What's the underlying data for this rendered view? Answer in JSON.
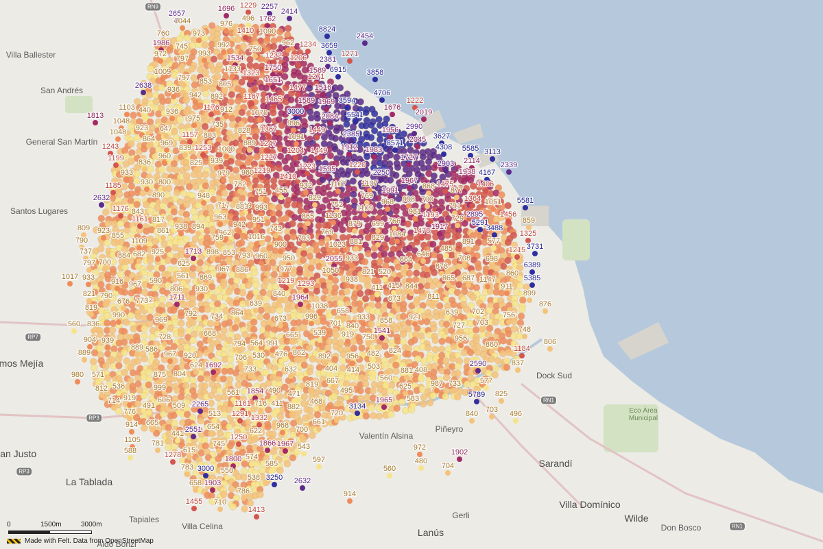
{
  "attribution": "Made with Felt. Data from OpenStreetMap",
  "scale": {
    "labels": [
      "0",
      "1500m",
      "3000m"
    ]
  },
  "colors": {
    "water": "#b6c9dc",
    "land": "#ecebe6",
    "park": "#d4e2c4",
    "palette": [
      "#f7e48a",
      "#f4c27a",
      "#ef8c5a",
      "#d4564e",
      "#a22a66",
      "#5b2a8a",
      "#2f2fa0"
    ]
  },
  "places": [
    {
      "name": "Villa Ballester"
    },
    {
      "name": "San Andrés"
    },
    {
      "name": "General San Martín"
    },
    {
      "name": "Santos Lugares"
    },
    {
      "name": "Ramos Mejía"
    },
    {
      "name": "San Justo"
    },
    {
      "name": "La Tablada"
    },
    {
      "name": "Tapiales"
    },
    {
      "name": "Villa Celina"
    },
    {
      "name": "Aldo Bonzi"
    },
    {
      "name": "Valentín Alsina"
    },
    {
      "name": "Piñeyro"
    },
    {
      "name": "Gerli"
    },
    {
      "name": "Lanús"
    },
    {
      "name": "Sarandí"
    },
    {
      "name": "Villa Domínico"
    },
    {
      "name": "Wilde"
    },
    {
      "name": "Don Bosco"
    },
    {
      "name": "Dock Sud"
    },
    {
      "name": "Eco Área Municipal"
    }
  ],
  "roads": [
    "RN9",
    "RP7",
    "RP3",
    "RP3",
    "RN1",
    "RN1"
  ],
  "labeled_points": [
    {
      "value": 2657
    },
    {
      "value": 1696
    },
    {
      "value": 1229
    },
    {
      "value": 2257
    },
    {
      "value": 2414
    },
    {
      "value": 1044
    },
    {
      "value": 976
    },
    {
      "value": 496
    },
    {
      "value": 1762
    },
    {
      "value": 760
    },
    {
      "value": 973
    },
    {
      "value": 1410
    },
    {
      "value": 1090
    },
    {
      "value": 8824
    },
    {
      "value": 2454
    },
    {
      "value": 1986
    },
    {
      "value": 745
    },
    {
      "value": 992
    },
    {
      "value": 962
    },
    {
      "value": 1234
    },
    {
      "value": 3659
    },
    {
      "value": 1271
    },
    {
      "value": 972
    },
    {
      "value": 797
    },
    {
      "value": 993
    },
    {
      "value": 750
    },
    {
      "value": 1534
    },
    {
      "value": 1232
    },
    {
      "value": 1206
    },
    {
      "value": 2381
    },
    {
      "value": 1009
    },
    {
      "value": 1133
    },
    {
      "value": 1323
    },
    {
      "value": 1750
    },
    {
      "value": 1589
    },
    {
      "value": 6915
    },
    {
      "value": 3858
    },
    {
      "value": 853
    },
    {
      "value": 805
    },
    {
      "value": 1651
    },
    {
      "value": 1271
    },
    {
      "value": 2638
    },
    {
      "value": 936
    },
    {
      "value": 797
    },
    {
      "value": 1477
    },
    {
      "value": 1516
    },
    {
      "value": 4706
    },
    {
      "value": 942
    },
    {
      "value": 892
    },
    {
      "value": 1167
    },
    {
      "value": 1465
    },
    {
      "value": 1589
    },
    {
      "value": 1969
    },
    {
      "value": 3594
    },
    {
      "value": 1222
    },
    {
      "value": 1103
    },
    {
      "value": 440
    },
    {
      "value": 936
    },
    {
      "value": 1176
    },
    {
      "value": 912
    },
    {
      "value": 1070
    },
    {
      "value": 3000
    },
    {
      "value": 2084
    },
    {
      "value": 5541
    },
    {
      "value": 1676
    },
    {
      "value": 2019
    },
    {
      "value": 1813
    },
    {
      "value": 1048
    },
    {
      "value": 975
    },
    {
      "value": 735
    },
    {
      "value": 996
    },
    {
      "value": 2990
    },
    {
      "value": 1048
    },
    {
      "value": 923
    },
    {
      "value": 647
    },
    {
      "value": 828
    },
    {
      "value": 1367
    },
    {
      "value": 1449
    },
    {
      "value": 2385
    },
    {
      "value": 1956
    },
    {
      "value": 3627
    },
    {
      "value": 1243
    },
    {
      "value": 864
    },
    {
      "value": 969
    },
    {
      "value": 1157
    },
    {
      "value": 803
    },
    {
      "value": 889
    },
    {
      "value": 1247
    },
    {
      "value": 1091
    },
    {
      "value": 1912
    },
    {
      "value": 8571
    },
    {
      "value": 2045
    },
    {
      "value": 4308
    },
    {
      "value": 5585
    },
    {
      "value": 3113
    },
    {
      "value": 1199
    },
    {
      "value": 960
    },
    {
      "value": 839
    },
    {
      "value": 1253
    },
    {
      "value": 1000
    },
    {
      "value": 1204
    },
    {
      "value": 1449
    },
    {
      "value": 1983
    },
    {
      "value": 1727
    },
    {
      "value": 836
    },
    {
      "value": 825
    },
    {
      "value": 939
    },
    {
      "value": 1227
    },
    {
      "value": 1223
    },
    {
      "value": 1595
    },
    {
      "value": 1220
    },
    {
      "value": 2903
    },
    {
      "value": 2114
    },
    {
      "value": 2339
    },
    {
      "value": 933
    },
    {
      "value": 1219
    },
    {
      "value": 979
    },
    {
      "value": 960
    },
    {
      "value": 1410
    },
    {
      "value": 2250
    },
    {
      "value": 1938
    },
    {
      "value": 4167
    },
    {
      "value": 930
    },
    {
      "value": 800
    },
    {
      "value": 1107
    },
    {
      "value": 1107
    },
    {
      "value": 1967
    },
    {
      "value": 1475
    },
    {
      "value": 1406
    },
    {
      "value": 1185
    },
    {
      "value": 782
    },
    {
      "value": 932
    },
    {
      "value": 1991
    },
    {
      "value": 868
    },
    {
      "value": 877
    },
    {
      "value": 890
    },
    {
      "value": 948
    },
    {
      "value": 751
    },
    {
      "value": 455
    },
    {
      "value": 829
    },
    {
      "value": 769
    },
    {
      "value": 998
    },
    {
      "value": 700
    },
    {
      "value": 1364
    },
    {
      "value": 2632
    },
    {
      "value": 717
    },
    {
      "value": 519
    },
    {
      "value": 993
    },
    {
      "value": 752
    },
    {
      "value": 968
    },
    {
      "value": 791
    },
    {
      "value": 1051
    },
    {
      "value": 5581
    },
    {
      "value": 1176
    },
    {
      "value": 843
    },
    {
      "value": 1161
    },
    {
      "value": 963
    },
    {
      "value": 883
    },
    {
      "value": 951
    },
    {
      "value": 865
    },
    {
      "value": 1136
    },
    {
      "value": 1109
    },
    {
      "value": 981
    },
    {
      "value": 1193
    },
    {
      "value": 2895
    },
    {
      "value": 1456
    },
    {
      "value": 817
    },
    {
      "value": 938
    },
    {
      "value": 894
    },
    {
      "value": 942
    },
    {
      "value": 743
    },
    {
      "value": 769
    },
    {
      "value": 879
    },
    {
      "value": 699
    },
    {
      "value": 766
    },
    {
      "value": 1917
    },
    {
      "value": 729
    },
    {
      "value": 5291
    },
    {
      "value": 859
    },
    {
      "value": 809
    },
    {
      "value": 923
    },
    {
      "value": 861
    },
    {
      "value": 962
    },
    {
      "value": 1016
    },
    {
      "value": 1084
    },
    {
      "value": 1478
    },
    {
      "value": 3488
    },
    {
      "value": 1325
    },
    {
      "value": 790
    },
    {
      "value": 855
    },
    {
      "value": 1109
    },
    {
      "value": 759
    },
    {
      "value": 900
    },
    {
      "value": 793
    },
    {
      "value": 1023
    },
    {
      "value": 881
    },
    {
      "value": 829
    },
    {
      "value": 891
    },
    {
      "value": 577
    },
    {
      "value": 3731
    },
    {
      "value": 737
    },
    {
      "value": 884
    },
    {
      "value": 682
    },
    {
      "value": 925
    },
    {
      "value": 1713
    },
    {
      "value": 898
    },
    {
      "value": 853
    },
    {
      "value": 793
    },
    {
      "value": 960
    },
    {
      "value": 485
    },
    {
      "value": 1215
    },
    {
      "value": 797
    },
    {
      "value": 700
    },
    {
      "value": 625
    },
    {
      "value": 950
    },
    {
      "value": 2055
    },
    {
      "value": 933
    },
    {
      "value": 664
    },
    {
      "value": 646
    },
    {
      "value": 708
    },
    {
      "value": 698
    },
    {
      "value": 6389
    },
    {
      "value": 1017
    },
    {
      "value": 933
    },
    {
      "value": 561
    },
    {
      "value": 869
    },
    {
      "value": 967
    },
    {
      "value": 886
    },
    {
      "value": 977
    },
    {
      "value": 1050
    },
    {
      "value": 821
    },
    {
      "value": 520
    },
    {
      "value": 878
    },
    {
      "value": 865
    },
    {
      "value": 687
    },
    {
      "value": 860
    },
    {
      "value": 5385
    },
    {
      "value": 916
    },
    {
      "value": 967
    },
    {
      "value": 590
    },
    {
      "value": 806
    },
    {
      "value": 930
    },
    {
      "value": 1219
    },
    {
      "value": 1293
    },
    {
      "value": 938
    },
    {
      "value": 411
    },
    {
      "value": 415
    },
    {
      "value": 844
    },
    {
      "value": 1147
    },
    {
      "value": 911
    },
    {
      "value": 821
    },
    {
      "value": 790
    },
    {
      "value": 1711
    },
    {
      "value": 840
    },
    {
      "value": 1964
    },
    {
      "value": 1038
    },
    {
      "value": 658
    },
    {
      "value": 673
    },
    {
      "value": 542
    },
    {
      "value": 899
    },
    {
      "value": 819
    },
    {
      "value": 676
    },
    {
      "value": 773
    },
    {
      "value": 639
    },
    {
      "value": 811
    },
    {
      "value": 876
    },
    {
      "value": 990
    },
    {
      "value": 792
    },
    {
      "value": 734
    },
    {
      "value": 864
    },
    {
      "value": 996
    },
    {
      "value": 701
    },
    {
      "value": 933
    },
    {
      "value": 858
    },
    {
      "value": 639
    },
    {
      "value": 702
    },
    {
      "value": 756
    },
    {
      "value": 560
    },
    {
      "value": 836
    },
    {
      "value": 969
    },
    {
      "value": 673
    },
    {
      "value": 539
    },
    {
      "value": 840
    },
    {
      "value": 921
    },
    {
      "value": 727
    },
    {
      "value": 703
    },
    {
      "value": 904
    },
    {
      "value": 939
    },
    {
      "value": 728
    },
    {
      "value": 668
    },
    {
      "value": 794
    },
    {
      "value": 564
    },
    {
      "value": 991
    },
    {
      "value": 665
    },
    {
      "value": 919
    },
    {
      "value": 750
    },
    {
      "value": 1541
    },
    {
      "value": 956
    },
    {
      "value": 748
    },
    {
      "value": 806
    },
    {
      "value": 889
    },
    {
      "value": 889
    },
    {
      "value": 586
    },
    {
      "value": 967
    },
    {
      "value": 920
    },
    {
      "value": 706
    },
    {
      "value": 530
    },
    {
      "value": 476
    },
    {
      "value": 862
    },
    {
      "value": 892
    },
    {
      "value": 956
    },
    {
      "value": 482
    },
    {
      "value": 824
    },
    {
      "value": 860
    },
    {
      "value": 1184
    },
    {
      "value": 980
    },
    {
      "value": 571
    },
    {
      "value": 875
    },
    {
      "value": 804
    },
    {
      "value": 624
    },
    {
      "value": 1692
    },
    {
      "value": 733
    },
    {
      "value": 632
    },
    {
      "value": 404
    },
    {
      "value": 414
    },
    {
      "value": 503
    },
    {
      "value": 881
    },
    {
      "value": 408
    },
    {
      "value": 2590
    },
    {
      "value": 837
    },
    {
      "value": 812
    },
    {
      "value": 536
    },
    {
      "value": 999
    },
    {
      "value": 561
    },
    {
      "value": 1854
    },
    {
      "value": 490
    },
    {
      "value": 471
    },
    {
      "value": 819
    },
    {
      "value": 667
    },
    {
      "value": 638
    },
    {
      "value": 560
    },
    {
      "value": 625
    },
    {
      "value": 987
    },
    {
      "value": 733
    },
    {
      "value": 577
    },
    {
      "value": 714
    },
    {
      "value": 919
    },
    {
      "value": 606
    },
    {
      "value": 1161
    },
    {
      "value": 716
    },
    {
      "value": 411
    },
    {
      "value": 882
    },
    {
      "value": 468
    },
    {
      "value": 495
    },
    {
      "value": 1965
    },
    {
      "value": 583
    },
    {
      "value": 5789
    },
    {
      "value": 825
    },
    {
      "value": 776
    },
    {
      "value": 491
    },
    {
      "value": 509
    },
    {
      "value": 2265
    },
    {
      "value": 3134
    },
    {
      "value": 703
    },
    {
      "value": 496
    },
    {
      "value": 914
    },
    {
      "value": 665
    },
    {
      "value": 513
    },
    {
      "value": 1291
    },
    {
      "value": 1332
    },
    {
      "value": 720
    },
    {
      "value": 840
    },
    {
      "value": 968
    },
    {
      "value": 700
    },
    {
      "value": 661
    },
    {
      "value": 441
    },
    {
      "value": 2551
    },
    {
      "value": 654
    },
    {
      "value": 622
    },
    {
      "value": 1105
    },
    {
      "value": 781
    },
    {
      "value": 1250
    },
    {
      "value": 1866
    },
    {
      "value": 1967
    },
    {
      "value": 543
    },
    {
      "value": 972
    },
    {
      "value": 588
    },
    {
      "value": 1278
    },
    {
      "value": 615
    },
    {
      "value": 745
    },
    {
      "value": 1902
    },
    {
      "value": 1800
    },
    {
      "value": 574
    },
    {
      "value": 597
    },
    {
      "value": 480
    },
    {
      "value": 783
    },
    {
      "value": 3000
    },
    {
      "value": 550
    },
    {
      "value": 585
    },
    {
      "value": 704
    },
    {
      "value": 560
    },
    {
      "value": 658
    },
    {
      "value": 1903
    },
    {
      "value": 538
    },
    {
      "value": 3250
    },
    {
      "value": 2632
    },
    {
      "value": 786
    },
    {
      "value": 914
    },
    {
      "value": 1455
    },
    {
      "value": 710
    },
    {
      "value": 1413
    }
  ]
}
